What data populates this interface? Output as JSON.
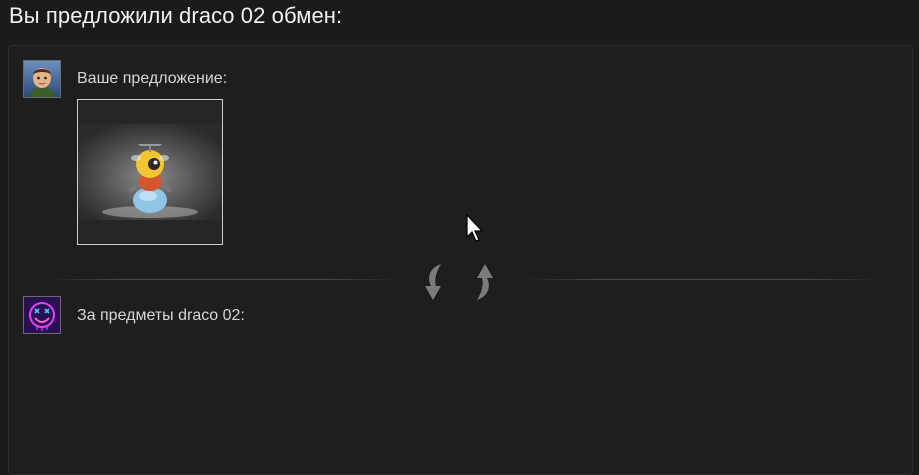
{
  "header": {
    "title": "Вы предложили draco 02 обмен:"
  },
  "your_offer": {
    "label": "Ваше предложение:",
    "avatar_icon": "user-avatar-icon",
    "items": [
      {
        "icon": "bee-snowman-toy-icon"
      }
    ]
  },
  "their_items": {
    "label": "За предметы draco 02:",
    "avatar_icon": "partner-avatar-icon",
    "items": []
  },
  "swap_icon": "swap-arrows-icon",
  "colors": {
    "background": "#1b1b1b",
    "panel": "#1e1e1e",
    "text": "#d6d6d6",
    "title": "#f2f2f2",
    "partner_avatar_bg": "#3a1a6a",
    "partner_avatar_accent": "#e040fb"
  }
}
